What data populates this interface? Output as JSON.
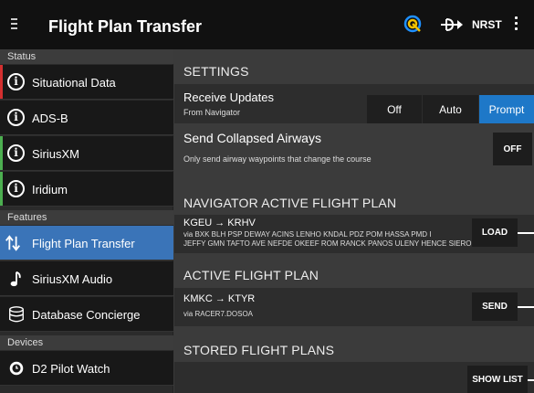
{
  "header": {
    "title": "Flight Plan Transfer",
    "nrst_label": "NRST",
    "icons": [
      "menu-icon",
      "weather-icon",
      "flight-plan-transfer-icon",
      "overflow-icon"
    ]
  },
  "sidebar": {
    "sections": [
      "Status",
      "Features",
      "Devices"
    ],
    "status_items": [
      {
        "label": "Situational Data",
        "icon": "info-icon",
        "indicator": "#d32f2f"
      },
      {
        "label": "ADS-B",
        "icon": "info-icon",
        "indicator": ""
      },
      {
        "label": "SiriusXM",
        "icon": "info-icon",
        "indicator": "#4caf50"
      },
      {
        "label": "Iridium",
        "icon": "info-icon",
        "indicator": "#4caf50"
      }
    ],
    "feature_items": [
      {
        "label": "Flight Plan Transfer",
        "icon": "transfer-arrows-icon",
        "active": true
      },
      {
        "label": "SiriusXM Audio",
        "icon": "music-note-icon"
      },
      {
        "label": "Database Concierge",
        "icon": "database-icon"
      }
    ],
    "device_items": [
      {
        "label": "D2 Pilot Watch",
        "icon": "watch-icon"
      }
    ]
  },
  "settings": {
    "title": "SETTINGS",
    "receive_updates": {
      "label": "Receive Updates",
      "sublabel": "From Navigator",
      "options": [
        "Off",
        "Auto",
        "Prompt"
      ],
      "selected": "Prompt"
    },
    "collapsed_airways": {
      "label": "Send Collapsed Airways",
      "sublabel": "Only send airway waypoints that change the course",
      "toggle_label": "OFF"
    }
  },
  "navigator_plan": {
    "title": "NAVIGATOR ACTIVE FLIGHT PLAN",
    "route": "KGEU → KRHV",
    "via_line1": "via BXK BLH PSP DEWAY ACINS LENHO KNDAL PDZ POM HASSA PMD I",
    "via_line2": "JEFFY GMN TAFTO AVE NEFDE OKEEF ROM RANCK PANOS ULENY HENCE SIERO",
    "button": "LOAD"
  },
  "active_plan": {
    "title": "ACTIVE FLIGHT PLAN",
    "route": "KMKC → KTYR",
    "via": "via RACER7.DOSOA",
    "button": "SEND"
  },
  "stored_plans": {
    "title": "STORED FLIGHT PLANS",
    "button": "SHOW LIST"
  },
  "colors": {
    "accent": "#1e78c8",
    "active_item": "#3a74b8",
    "alert": "#d32f2f",
    "ok": "#4caf50"
  }
}
